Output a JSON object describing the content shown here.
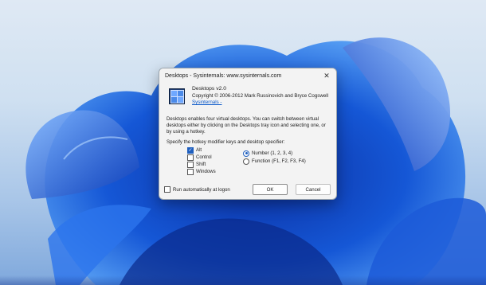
{
  "dialog": {
    "title": "Desktops - Sysinternals: www.sysinternals.com",
    "close_icon": "close-icon",
    "app_icon": "desktops-app-icon",
    "app_name": "Desktops v2.0",
    "copyright": "Copyright © 2006-2012 Mark Russinovich and Bryce Cogswell",
    "link": "Sysinternals -",
    "description": "Desktops enables four virtual desktops. You can switch between virtual desktops either by clicking on the Desktops tray icon and selecting one, or by using a hotkey.",
    "specify_label": "Specify the hotkey modifier keys and desktop specifier:",
    "modifiers": [
      {
        "label": "Alt",
        "checked": true
      },
      {
        "label": "Control",
        "checked": false
      },
      {
        "label": "Shift",
        "checked": false
      },
      {
        "label": "Windows",
        "checked": false
      }
    ],
    "specifiers": [
      {
        "label": "Number (1, 2, 3, 4)",
        "selected": true
      },
      {
        "label": "Function (F1, F2, F3, F4)",
        "selected": false
      }
    ],
    "run_at_logon_label": "Run automatically at logon",
    "run_at_logon_checked": false,
    "ok_label": "OK",
    "cancel_label": "Cancel"
  },
  "colors": {
    "accent": "#1f5fbf",
    "link": "#0a58c9",
    "wallpaper_bloom": "#1a5fe0"
  }
}
